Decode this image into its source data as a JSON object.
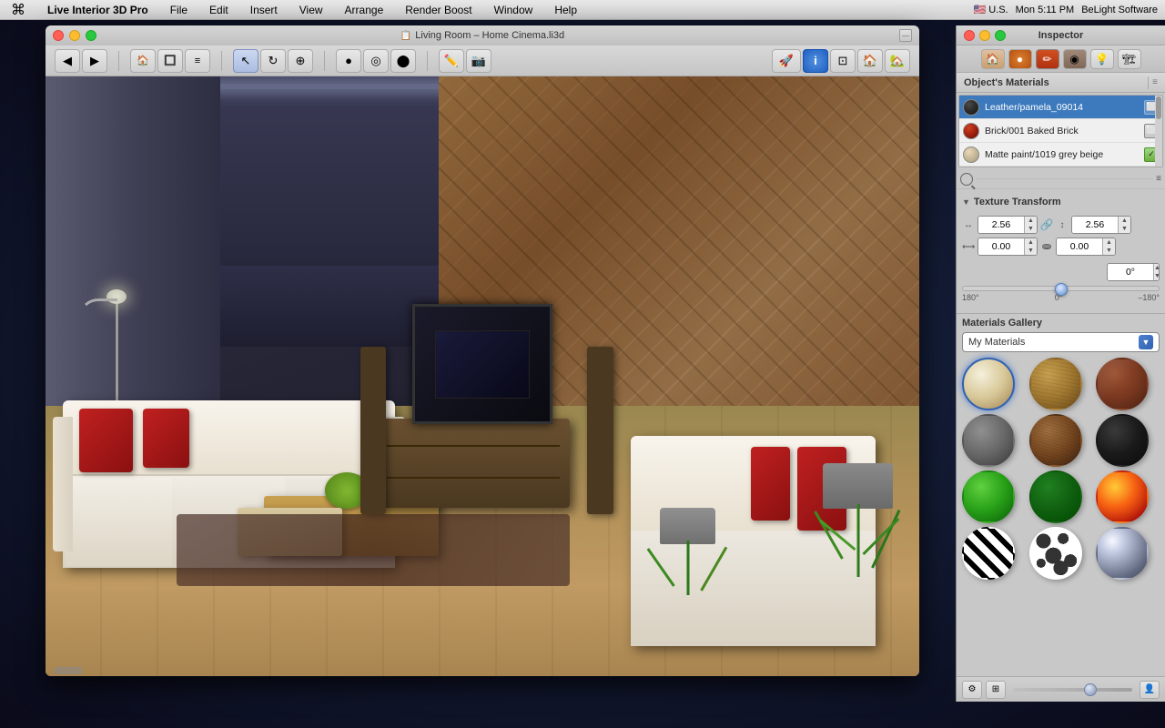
{
  "menubar": {
    "apple": "⌘",
    "appName": "Live Interior 3D Pro",
    "menus": [
      "File",
      "Edit",
      "Insert",
      "View",
      "Arrange",
      "Render Boost",
      "Window",
      "Help"
    ],
    "rightItems": [
      "U.S.",
      "Mon 5:11 PM",
      "BeLight Software"
    ]
  },
  "window": {
    "title": "Living Room – Home Cinema.li3d",
    "trafficLights": [
      "close",
      "minimize",
      "maximize"
    ]
  },
  "inspector": {
    "title": "Inspector",
    "tabs": [
      "house-icon",
      "circle-icon",
      "pen-icon",
      "material-icon",
      "light-icon",
      "building-icon"
    ],
    "objectsMaterials": {
      "heading": "Object's Materials",
      "materials": [
        {
          "name": "Leather/pamela_09014",
          "color": "#3a3a3a",
          "type": "dark"
        },
        {
          "name": "Brick/001 Baked Brick",
          "color": "#c03010",
          "type": "red"
        },
        {
          "name": "Matte paint/1019 grey beige",
          "color": "#d8c8a8",
          "type": "light"
        }
      ]
    },
    "textureTransform": {
      "heading": "Texture Transform",
      "scaleX": "2.56",
      "scaleY": "2.56",
      "offsetX": "0.00",
      "offsetY": "0.00",
      "angle": "0°",
      "sliderMin": "180°",
      "sliderCenter": "0°",
      "sliderMax": "–180°",
      "sliderPosition": 50
    },
    "materialsGallery": {
      "heading": "Materials Gallery",
      "dropdown": "My Materials",
      "materials": [
        {
          "id": "cream",
          "class": "mat-cream",
          "label": "Cream fabric",
          "selected": true
        },
        {
          "id": "wood-light",
          "class": "mat-wood-light",
          "label": "Light wood"
        },
        {
          "id": "brick-sphere",
          "class": "mat-brick",
          "label": "Brick"
        },
        {
          "id": "concrete",
          "class": "mat-concrete",
          "label": "Concrete"
        },
        {
          "id": "wood-med",
          "class": "mat-wood-dark",
          "label": "Medium wood"
        },
        {
          "id": "dark-brown",
          "class": "mat-dark-brown",
          "label": "Dark brown"
        },
        {
          "id": "green-bright",
          "class": "mat-green-bright",
          "label": "Green"
        },
        {
          "id": "green-dark",
          "class": "mat-green-dark",
          "label": "Dark green"
        },
        {
          "id": "fire",
          "class": "mat-fire",
          "label": "Fire"
        },
        {
          "id": "zebra",
          "class": "mat-zebra",
          "label": "Zebra"
        },
        {
          "id": "spots",
          "class": "mat-spots",
          "label": "Spots"
        },
        {
          "id": "chrome",
          "class": "mat-chrome",
          "label": "Chrome"
        }
      ]
    }
  }
}
